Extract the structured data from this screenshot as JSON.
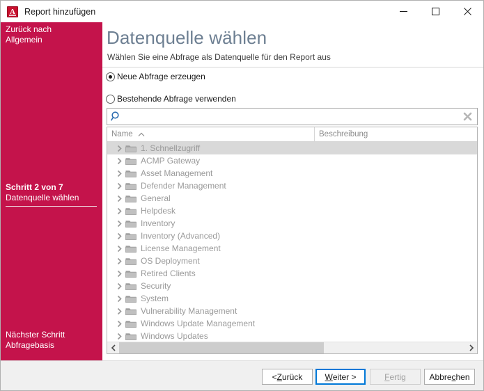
{
  "window": {
    "title": "Report hinzufügen",
    "app_icon": "acmp-a-icon",
    "icon_letter": "A",
    "controls": {
      "minimize": "minimize-icon",
      "maximize": "maximize-icon",
      "close": "close-icon"
    }
  },
  "sidebar": {
    "accent_color": "#c4134b",
    "back_link_line1": "Zurück nach",
    "back_link_line2": "Allgemein",
    "step_count": "Schritt 2 von 7",
    "step_name": "Datenquelle wählen",
    "next_label": "Nächster Schritt",
    "next_name": "Abfragebasis"
  },
  "header": {
    "title": "Datenquelle wählen",
    "subtitle": "Wählen Sie eine Abfrage als Datenquelle für den Report aus",
    "title_color": "#6d7f92"
  },
  "options": {
    "new_query": {
      "label": "Neue Abfrage erzeugen",
      "selected": true
    },
    "existing_query": {
      "label": "Bestehende Abfrage verwenden",
      "selected": false
    }
  },
  "search": {
    "value": "",
    "placeholder": "",
    "icon": "search-icon",
    "clear_icon": "clear-icon"
  },
  "grid": {
    "columns": [
      {
        "key": "name",
        "label": "Name",
        "sort": "asc",
        "sort_icon": "chevron-up-icon"
      },
      {
        "key": "description",
        "label": "Beschreibung",
        "sort": "none"
      }
    ],
    "rows": [
      {
        "label": "1. Schnellzugriff",
        "description": "",
        "selected": true,
        "expandable": true,
        "icon": "folder-icon"
      },
      {
        "label": "ACMP Gateway",
        "description": "",
        "selected": false,
        "expandable": true,
        "icon": "folder-icon"
      },
      {
        "label": "Asset Management",
        "description": "",
        "selected": false,
        "expandable": true,
        "icon": "folder-icon"
      },
      {
        "label": "Defender Management",
        "description": "",
        "selected": false,
        "expandable": true,
        "icon": "folder-icon"
      },
      {
        "label": "General",
        "description": "",
        "selected": false,
        "expandable": true,
        "icon": "folder-icon"
      },
      {
        "label": "Helpdesk",
        "description": "",
        "selected": false,
        "expandable": true,
        "icon": "folder-icon"
      },
      {
        "label": "Inventory",
        "description": "",
        "selected": false,
        "expandable": true,
        "icon": "folder-icon"
      },
      {
        "label": "Inventory (Advanced)",
        "description": "",
        "selected": false,
        "expandable": true,
        "icon": "folder-icon"
      },
      {
        "label": "License Management",
        "description": "",
        "selected": false,
        "expandable": true,
        "icon": "folder-icon"
      },
      {
        "label": "OS Deployment",
        "description": "",
        "selected": false,
        "expandable": true,
        "icon": "folder-icon"
      },
      {
        "label": "Retired Clients",
        "description": "",
        "selected": false,
        "expandable": true,
        "icon": "folder-icon"
      },
      {
        "label": "Security",
        "description": "",
        "selected": false,
        "expandable": true,
        "icon": "folder-icon"
      },
      {
        "label": "System",
        "description": "",
        "selected": false,
        "expandable": true,
        "icon": "folder-icon"
      },
      {
        "label": "Vulnerability Management",
        "description": "",
        "selected": false,
        "expandable": true,
        "icon": "folder-icon"
      },
      {
        "label": "Windows Update Management",
        "description": "",
        "selected": false,
        "expandable": true,
        "icon": "folder-icon"
      },
      {
        "label": "Windows Updates",
        "description": "",
        "selected": false,
        "expandable": true,
        "icon": "folder-icon"
      }
    ],
    "hscroll": {
      "left_arrow": "chevron-left-icon",
      "right_arrow": "chevron-right-icon"
    }
  },
  "footer": {
    "back": {
      "pre": "< ",
      "mnemonic": "Z",
      "post": "urück",
      "disabled": false,
      "default": false
    },
    "next": {
      "pre": "",
      "mnemonic": "W",
      "post": "eiter >",
      "disabled": false,
      "default": true
    },
    "finish": {
      "pre": "",
      "mnemonic": "F",
      "post": "ertig",
      "disabled": true,
      "default": false
    },
    "cancel": {
      "pre": "Abbre",
      "mnemonic": "c",
      "post": "hen",
      "disabled": false,
      "default": false
    }
  }
}
